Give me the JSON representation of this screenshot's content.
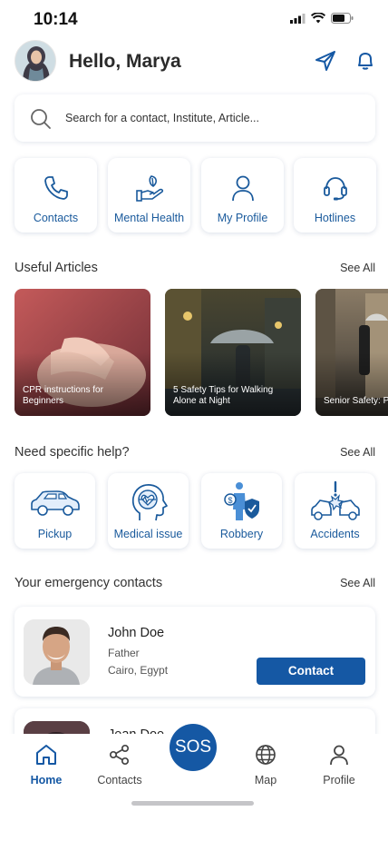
{
  "status": {
    "time": "10:14"
  },
  "header": {
    "greeting": "Hello, Marya"
  },
  "search": {
    "placeholder": "Search for a contact, Institute, Article..."
  },
  "quick_actions": [
    {
      "label": "Contacts",
      "icon": "phone-icon"
    },
    {
      "label": "Mental Health",
      "icon": "hand-leaf-icon"
    },
    {
      "label": "My Profile",
      "icon": "user-icon"
    },
    {
      "label": "Hotlines",
      "icon": "headset-icon"
    }
  ],
  "articles": {
    "title": "Useful Articles",
    "see_all": "See All",
    "items": [
      {
        "caption": "CPR instructions for Beginners"
      },
      {
        "caption": "5 Safety Tips for Walking Alone at Night"
      },
      {
        "caption": "Senior Safety: P Falls"
      }
    ]
  },
  "help": {
    "title": "Need specific help?",
    "see_all": "See All",
    "items": [
      {
        "label": "Pickup",
        "icon": "car-icon"
      },
      {
        "label": "Medical issue",
        "icon": "head-heart-icon"
      },
      {
        "label": "Robbery",
        "icon": "robbery-icon"
      },
      {
        "label": "Accidents",
        "icon": "car-crash-icon"
      }
    ]
  },
  "contacts": {
    "title": "Your emergency contacts",
    "see_all": "See All",
    "items": [
      {
        "name": "John Doe",
        "relation": "Father",
        "location": "Cairo, Egypt",
        "button": "Contact"
      },
      {
        "name": "Jean Doe"
      }
    ]
  },
  "tabbar": {
    "home": "Home",
    "contacts": "Contacts",
    "sos": "SOS",
    "map": "Map",
    "profile": "Profile"
  },
  "colors": {
    "accent": "#1558a4",
    "icon_blue": "#1a5a9c"
  }
}
